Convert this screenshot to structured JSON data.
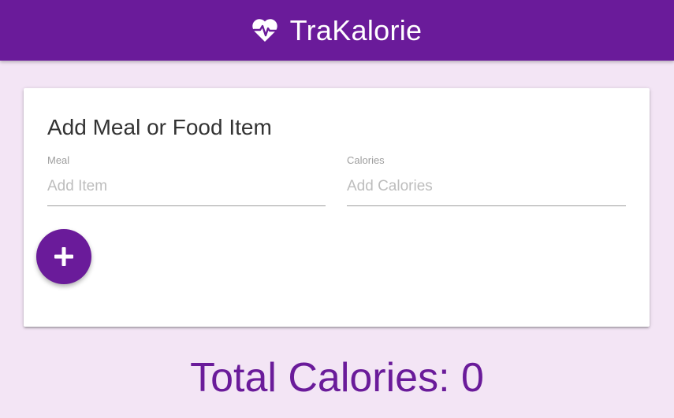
{
  "app": {
    "title": "TraKalorie",
    "logo_icon": "heartbeat-icon",
    "accent_color": "#6a1b9a",
    "background_color": "#f3e5f5"
  },
  "form": {
    "title": "Add Meal or Food Item",
    "meal_field": {
      "label": "Meal",
      "placeholder": "Add Item",
      "value": ""
    },
    "calories_field": {
      "label": "Calories",
      "placeholder": "Add Calories",
      "value": ""
    },
    "add_button": {
      "icon": "plus-icon"
    }
  },
  "summary": {
    "total_label": "Total Calories:",
    "total_value": "0"
  }
}
